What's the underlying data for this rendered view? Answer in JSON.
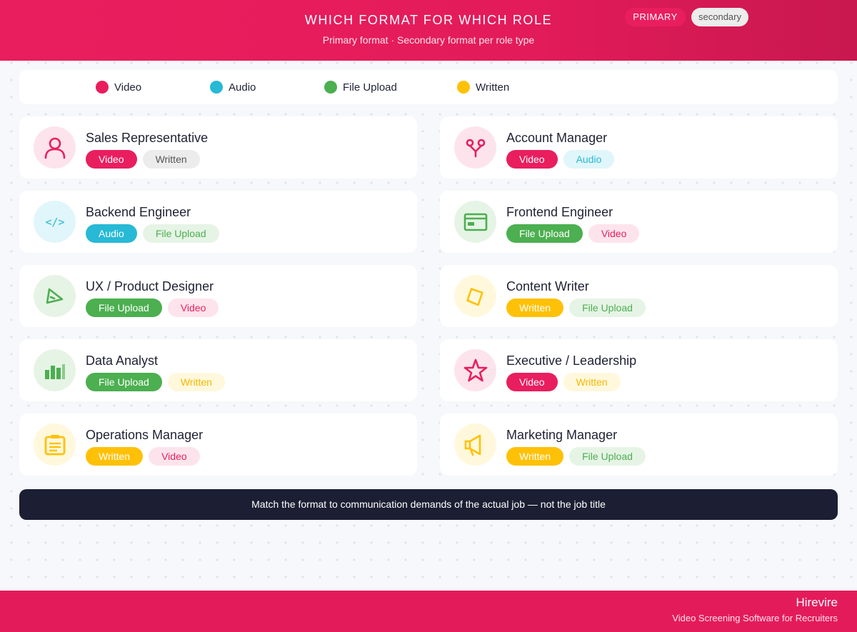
{
  "header": {
    "title": "WHICH FORMAT FOR WHICH ROLE",
    "subtitle": "Primary format · Secondary format per role type"
  },
  "formats": {
    "Video": {
      "color": "#e91e5e",
      "soft_bg": "#fde4ec",
      "soft_text": "#e91e5e"
    },
    "Audio": {
      "color": "#27b9d6",
      "soft_bg": "#e0f6fa",
      "soft_text": "#27b9d6"
    },
    "File Upload": {
      "color": "#4caf50",
      "soft_bg": "#e6f4e6",
      "soft_text": "#4caf50"
    },
    "Written": {
      "color": "#ffc107",
      "soft_bg": "#fff8dc",
      "soft_text": "#f5b800"
    }
  },
  "legend": {
    "items": [
      {
        "label": "Video"
      },
      {
        "label": "Audio"
      },
      {
        "label": "File Upload"
      },
      {
        "label": "Written"
      }
    ],
    "primary_label": "PRIMARY",
    "secondary_label": "secondary"
  },
  "roles": [
    {
      "name": "Sales Representative",
      "icon": "person-icon",
      "primary": "Video",
      "secondary": "Written",
      "secondary_neutral": true
    },
    {
      "name": "Account Manager",
      "icon": "handshake-icon",
      "primary": "Video",
      "secondary": "Audio"
    },
    {
      "name": "Backend Engineer",
      "icon": "code-icon",
      "primary": "Audio",
      "secondary": "File Upload"
    },
    {
      "name": "Frontend Engineer",
      "icon": "browser-window-icon",
      "primary": "File Upload",
      "secondary": "Video"
    },
    {
      "name": "UX / Product Designer",
      "icon": "pen-tool-icon",
      "primary": "File Upload",
      "secondary": "Video"
    },
    {
      "name": "Content Writer",
      "icon": "paper-icon",
      "primary": "Written",
      "secondary": "File Upload"
    },
    {
      "name": "Data Analyst",
      "icon": "bar-chart-icon",
      "primary": "File Upload",
      "secondary": "Written"
    },
    {
      "name": "Executive / Leadership",
      "icon": "star-icon",
      "primary": "Video",
      "secondary": "Written"
    },
    {
      "name": "Operations Manager",
      "icon": "clipboard-icon",
      "primary": "Written",
      "secondary": "Video"
    },
    {
      "name": "Marketing Manager",
      "icon": "megaphone-icon",
      "primary": "Written",
      "secondary": "File Upload"
    }
  ],
  "footer_note": "Match the format to communication demands of the actual job — not the job title",
  "brand": {
    "name": "Hirevire",
    "tagline": "Video Screening Software for Recruiters"
  }
}
